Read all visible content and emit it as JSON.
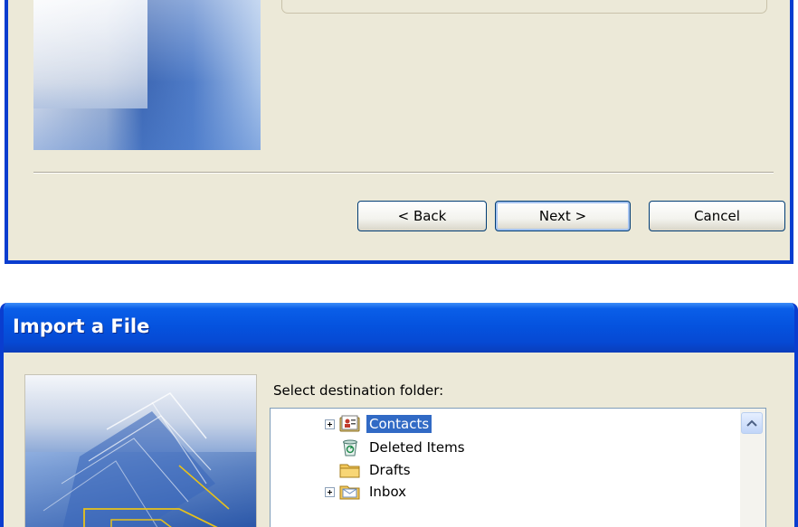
{
  "top_dialog": {
    "buttons": {
      "back_label": "< Back",
      "next_label": "Next >",
      "cancel_label": "Cancel"
    }
  },
  "import_dialog": {
    "title": "Import a File",
    "select_label": "Select destination folder:",
    "folders": [
      {
        "label": "Contacts",
        "icon": "contacts-folder-icon",
        "expandable": true,
        "selected": true
      },
      {
        "label": "Deleted Items",
        "icon": "recycle-bin-icon",
        "expandable": false,
        "selected": false
      },
      {
        "label": "Drafts",
        "icon": "folder-icon",
        "expandable": false,
        "selected": false
      },
      {
        "label": "Inbox",
        "icon": "inbox-folder-icon",
        "expandable": true,
        "selected": false
      }
    ]
  },
  "colors": {
    "titlebar_blue": "#0553df",
    "selection_blue": "#316ac5",
    "dialog_background": "#ece9d8"
  }
}
